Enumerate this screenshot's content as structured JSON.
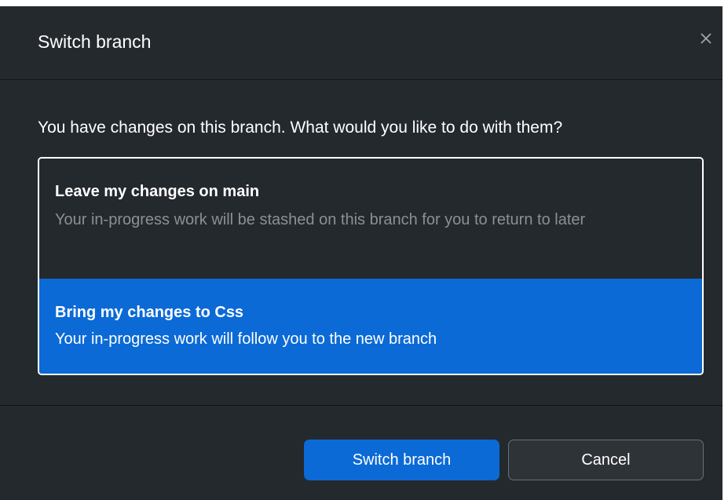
{
  "dialog": {
    "title": "Switch branch",
    "close_icon": "close-icon"
  },
  "body": {
    "prompt": "You have changes on this branch. What would you like to do with them?",
    "options": [
      {
        "title": "Leave my changes on main",
        "description": "Your in-progress work will be stashed on this branch for you to return to later",
        "selected": false
      },
      {
        "title": "Bring my changes to Css",
        "description": "Your in-progress work will follow you to the new branch",
        "selected": true
      }
    ]
  },
  "footer": {
    "primary_label": "Switch branch",
    "secondary_label": "Cancel"
  },
  "colors": {
    "background": "#24292e",
    "accent": "#0b6ad6",
    "text": "#ffffff",
    "muted_text": "#8b9096"
  }
}
